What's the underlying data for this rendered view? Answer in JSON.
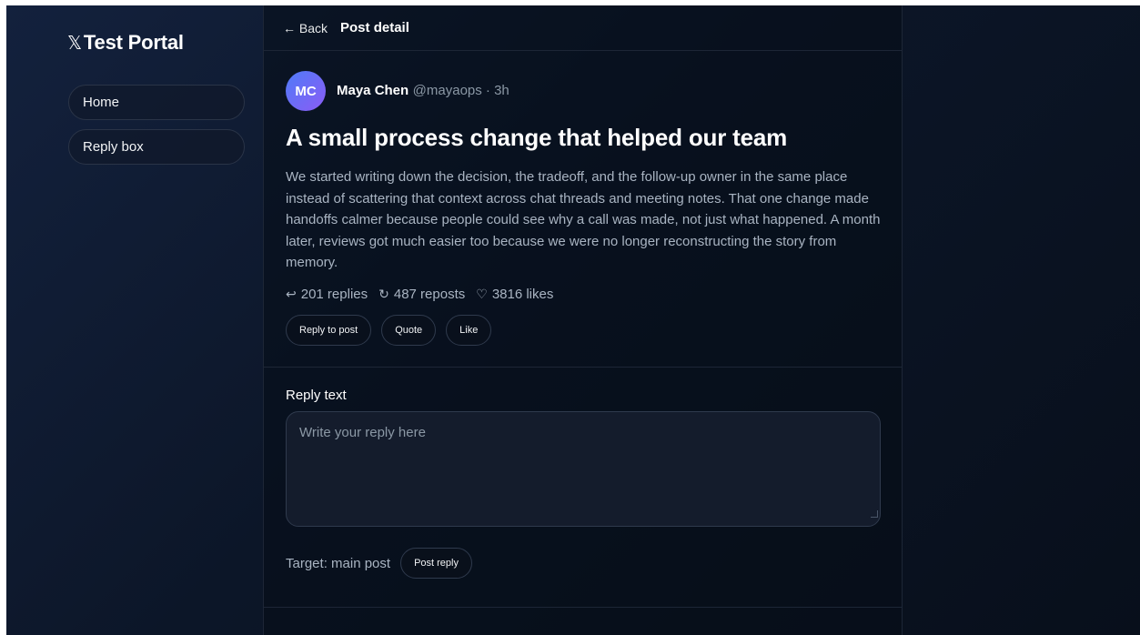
{
  "sidebar": {
    "logo_glyph": "𝕏",
    "brand": "Test Portal",
    "items": [
      {
        "label": "Home"
      },
      {
        "label": "Reply box"
      }
    ]
  },
  "header": {
    "back_label": "← Back",
    "title": "Post detail"
  },
  "post": {
    "avatar_initials": "MC",
    "author_name": "Maya Chen",
    "author_meta": "@mayaops · 3h",
    "title": "A small process change that helped our team",
    "body": "We started writing down the decision, the tradeoff, and the follow-up owner in the same place instead of scattering that context across chat threads and meeting notes. That one change made handoffs calmer because people could see why a call was made, not just what happened. A month later, reviews got much easier too because we were no longer reconstructing the story from memory.",
    "stats": {
      "replies_icon": "↩",
      "replies": "201 replies",
      "reposts_icon": "↻",
      "reposts": "487 reposts",
      "likes_icon": "♡",
      "likes": "3816 likes"
    },
    "actions": {
      "reply": "Reply to post",
      "quote": "Quote",
      "like": "Like"
    }
  },
  "reply": {
    "label": "Reply text",
    "placeholder": "Write your reply here",
    "target": "Target: main post",
    "submit": "Post reply"
  }
}
